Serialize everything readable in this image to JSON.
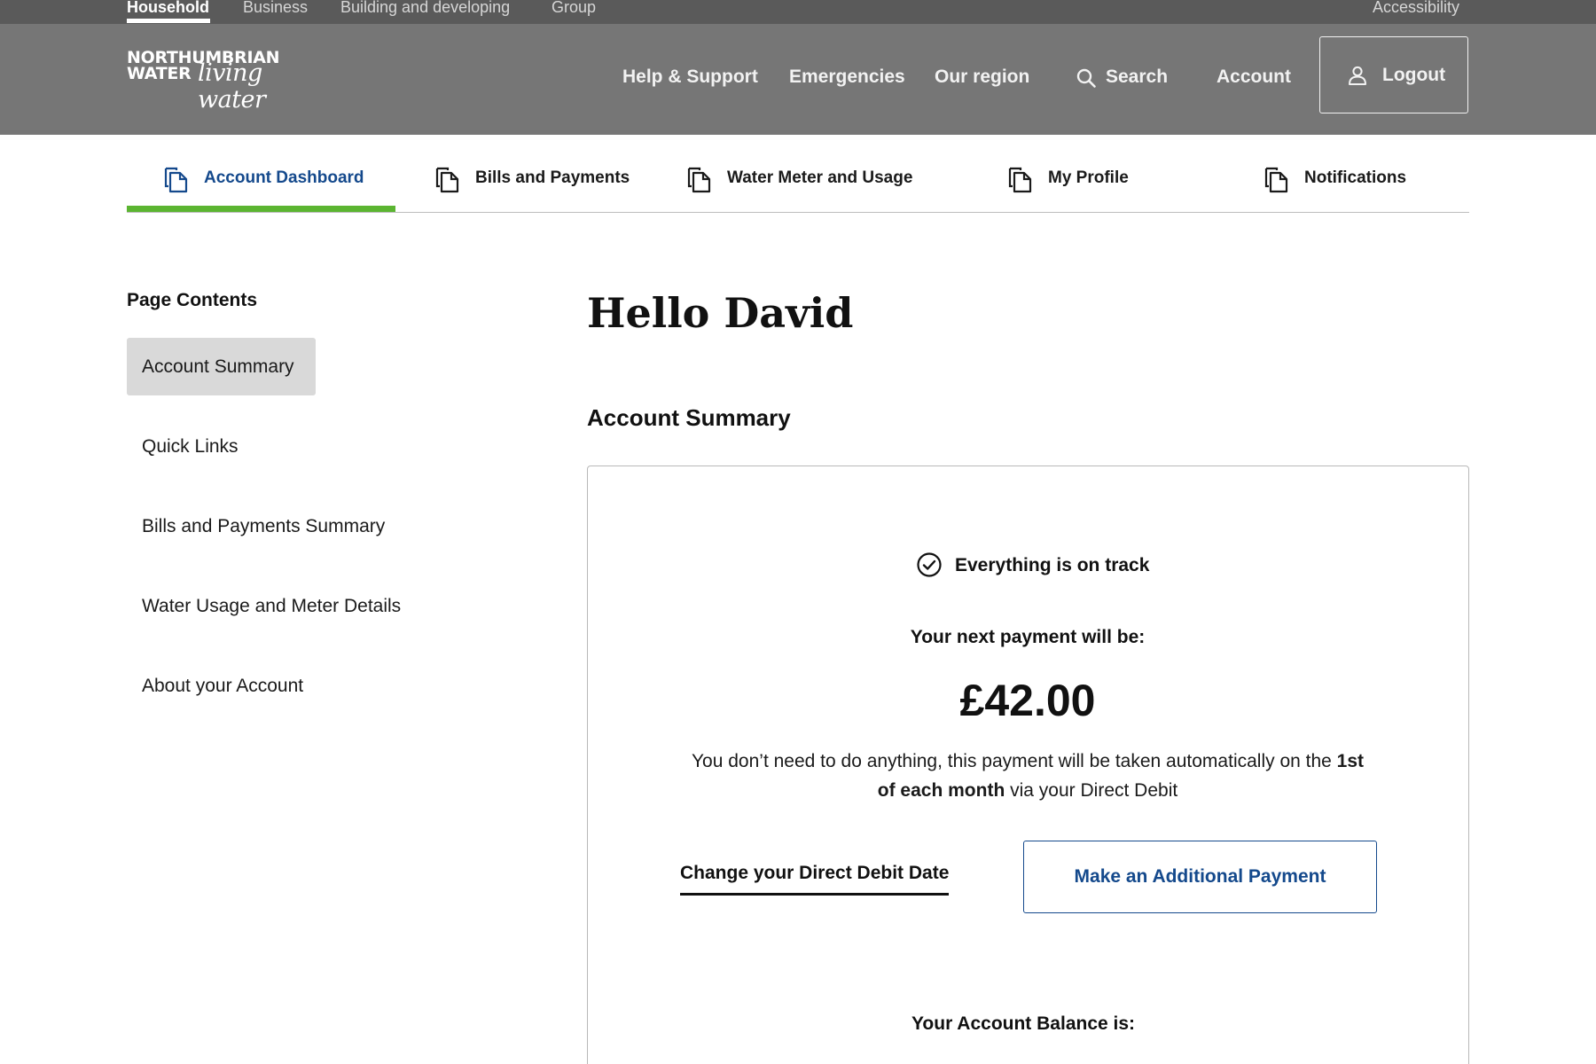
{
  "utility_bar": {
    "links": [
      "Household",
      "Business",
      "Building and developing",
      "Group"
    ],
    "active": "Household",
    "accessibility": "Accessibility"
  },
  "header": {
    "logo": {
      "line1": "NORTHUMBRIAN",
      "line2": "WATER",
      "script": "living water"
    },
    "nav": [
      "Help & Support",
      "Emergencies",
      "Our region"
    ],
    "search_label": "Search",
    "account_label": "Account",
    "logout_label": "Logout"
  },
  "tabs": [
    {
      "label": "Account Dashboard",
      "icon": "documents-icon",
      "active": true
    },
    {
      "label": "Bills and Payments",
      "icon": "documents-icon",
      "active": false
    },
    {
      "label": "Water Meter and Usage",
      "icon": "documents-icon",
      "active": false
    },
    {
      "label": "My Profile",
      "icon": "documents-icon",
      "active": false
    },
    {
      "label": "Notifications",
      "icon": "documents-icon",
      "active": false
    }
  ],
  "sidebar": {
    "title": "Page Contents",
    "items": [
      "Account Summary",
      "Quick Links",
      "Bills and Payments Summary",
      "Water Usage and Meter Details",
      "About your Account"
    ],
    "current": "Account Summary"
  },
  "main": {
    "greeting": "Hello David",
    "section_title": "Account Summary",
    "card": {
      "status_text": "Everything is on track",
      "next_payment_label": "Your next payment will be:",
      "amount": "£42.00",
      "note_before": "You don’t need to do anything, this payment will be taken automatically on the ",
      "note_bold": "1st of each month",
      "note_after": " via your Direct Debit",
      "change_link": "Change your Direct Debit Date",
      "extra_payment_button": "Make an Additional Payment",
      "balance_label": "Your Account Balance is:"
    }
  },
  "colors": {
    "utility_bar": "#5a5a5a",
    "header": "#767676",
    "brand_blue": "#14498c",
    "active_tab_bar": "#5bb531",
    "sidebar_current": "#d9d9d9"
  }
}
